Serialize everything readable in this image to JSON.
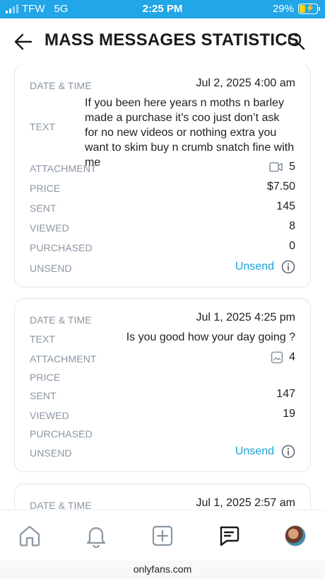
{
  "status_bar": {
    "carrier": "TFW",
    "network": "5G",
    "time": "2:25 PM",
    "battery_percent": "29%",
    "battery_level": 0.29
  },
  "header": {
    "title": "MASS MESSAGES STATISTICS",
    "back_icon": "arrow-left-icon",
    "search_icon": "search-icon"
  },
  "labels": {
    "date_time": "DATE & TIME",
    "text": "TEXT",
    "attachment": "ATTACHMENT",
    "price": "PRICE",
    "sent": "SENT",
    "viewed": "VIEWED",
    "purchased": "PURCHASED",
    "unsend": "UNSEND"
  },
  "messages": [
    {
      "date_time": "Jul 2, 2025 4:00 am",
      "text": "If you been here years n moths n barley made a purchase it’s coo just don’t ask for no new videos or nothing extra you want to skim buy n crumb snatch fine with me",
      "attachment_icon": "video-icon",
      "attachment_count": "5",
      "price": "$7.50",
      "sent": "145",
      "viewed": "8",
      "purchased": "0",
      "unsend_label": "Unsend"
    },
    {
      "date_time": "Jul 1, 2025 4:25 pm",
      "text": "Is you good how your day going ?",
      "attachment_icon": "image-icon",
      "attachment_count": "4",
      "price": "",
      "sent": "147",
      "viewed": "19",
      "purchased": "",
      "unsend_label": "Unsend"
    },
    {
      "date_time": "Jul 1, 2025 2:57 am"
    }
  ],
  "bottom_nav": {
    "items": [
      "home-icon",
      "bell-icon",
      "plus-square-icon",
      "messages-icon",
      "avatar"
    ]
  },
  "browser": {
    "url": "onlyfans.com"
  },
  "colors": {
    "status_bar": "#21a6e7",
    "accent": "#1aa3d6",
    "label": "#8a96a3",
    "border": "#e2e5e9"
  }
}
